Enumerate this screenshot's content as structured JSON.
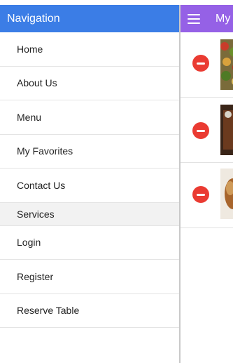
{
  "drawer": {
    "title": "Navigation",
    "items": [
      "Home",
      "About Us",
      "Menu",
      "My Favorites",
      "Contact Us"
    ],
    "section_header": "Services",
    "service_items": [
      "Login",
      "Register",
      "Reserve Table"
    ]
  },
  "app": {
    "title": "My",
    "favorites": [
      {
        "remove_icon": "remove-circle-icon"
      },
      {
        "remove_icon": "remove-circle-icon"
      },
      {
        "remove_icon": "remove-circle-icon"
      }
    ]
  },
  "colors": {
    "drawer_header": "#3b7de6",
    "app_toolbar": "#9561e6",
    "remove_button": "#ea3b32"
  }
}
